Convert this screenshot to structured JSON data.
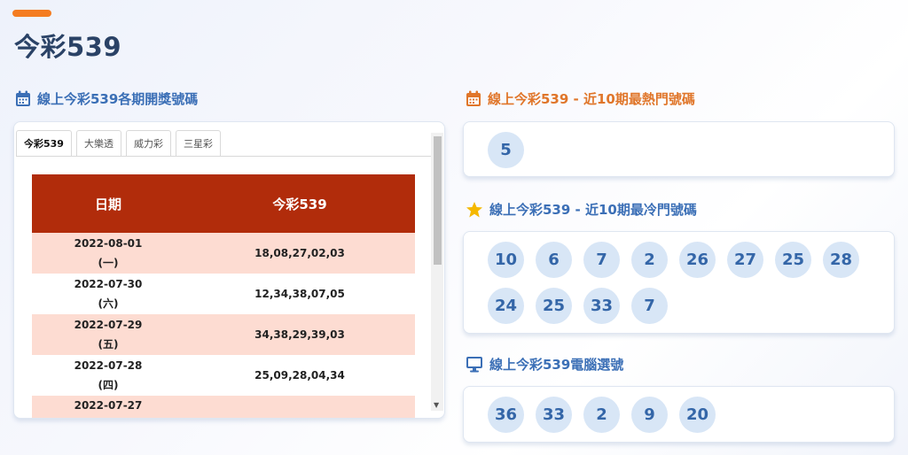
{
  "page": {
    "title": "今彩539"
  },
  "left_section": {
    "heading": "線上今彩539各期開獎號碼",
    "tabs": [
      {
        "label": "今彩539",
        "active": true
      },
      {
        "label": "大樂透",
        "active": false
      },
      {
        "label": "威力彩",
        "active": false
      },
      {
        "label": "三星彩",
        "active": false
      }
    ],
    "table": {
      "headers": [
        "日期",
        "今彩539"
      ],
      "rows": [
        {
          "date": "2022-08-01",
          "weekday": "(一)",
          "numbers": "18,08,27,02,03"
        },
        {
          "date": "2022-07-30",
          "weekday": "(六)",
          "numbers": "12,34,38,07,05"
        },
        {
          "date": "2022-07-29",
          "weekday": "(五)",
          "numbers": "34,38,29,39,03"
        },
        {
          "date": "2022-07-28",
          "weekday": "(四)",
          "numbers": "25,09,28,04,34"
        },
        {
          "date": "2022-07-27",
          "weekday": "",
          "numbers": ""
        }
      ]
    }
  },
  "hot_section": {
    "heading": "線上今彩539 - 近10期最熱門號碼",
    "numbers": [
      "5"
    ]
  },
  "cold_section": {
    "heading": "線上今彩539 - 近10期最冷門號碼",
    "numbers": [
      "10",
      "6",
      "7",
      "2",
      "26",
      "27",
      "25",
      "28",
      "24",
      "25",
      "33",
      "7"
    ]
  },
  "pick_section": {
    "heading": "線上今彩539電腦選號",
    "numbers": [
      "36",
      "33",
      "2",
      "9",
      "20"
    ]
  },
  "colors": {
    "accent": "#f47c20",
    "title": "#2a4266",
    "section_blue": "#3b6fb6",
    "section_orange": "#e0762a",
    "table_header": "#b12c0b",
    "table_stripe": "#fddcd2",
    "ball_bg": "#d8e6f6",
    "ball_text": "#3466a8"
  },
  "icons": {
    "left_heading": "calendar-icon",
    "hot_heading": "calendar-icon",
    "cold_heading": "star-icon",
    "pick_heading": "monitor-icon"
  }
}
